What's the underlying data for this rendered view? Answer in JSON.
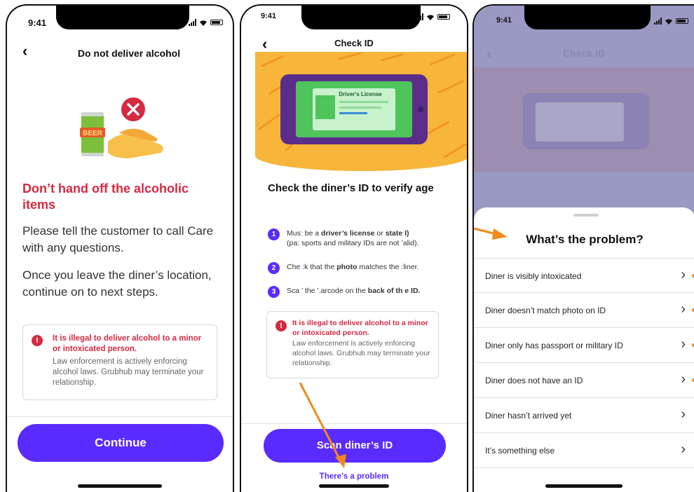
{
  "status": {
    "time": "9:41"
  },
  "screen1": {
    "title": "Do not deliver alcohol",
    "can_label": "BEER",
    "headline": "Don’t hand off the alcoholic items",
    "body1": "Please tell the customer to call Care with any questions.",
    "body2": "Once you leave the diner’s location, continue on to next steps.",
    "warning_title": "It is illegal to deliver alcohol to a minor or intoxicated person.",
    "warning_body": "Law enforcement is actively enforcing alcohol laws. Grubhub may terminate your relationship.",
    "button": "Continue"
  },
  "screen2": {
    "title": "Check ID",
    "card_label": "Driver's License",
    "headline": "Check the diner’s ID to verify age",
    "steps": [
      {
        "num": "1",
        "pre": "Mus",
        "mid1": ": be a ",
        "bold1": "driver’s license",
        "mid2": " or ",
        "bold2": "state I",
        "tail": ")",
        "line2": "(pa: sports  and military IDs are not ’alid)."
      },
      {
        "num": "2",
        "pre": "Che :k that the ",
        "bold1": "photo",
        "post": " matches the :liner."
      },
      {
        "num": "3",
        "pre": "Sca ’ the ’.arcode on the ",
        "bold1": "back of th e ID."
      }
    ],
    "warning_title": "It is illegal to deliver alcohol to a minor or intoxicated person.",
    "warning_body": "Law enforcement is actively enforcing alcohol laws. Grubhub may terminate your relationship.",
    "button": "Scan diner’s ID",
    "link": "There’s a problem"
  },
  "screen3": {
    "title": "Check ID",
    "sheet_title": "What’s the problem?",
    "options": [
      {
        "label": "Diner is visibly intoxicated",
        "marked": true
      },
      {
        "label": "Diner doesn’t match photo on ID",
        "marked": true
      },
      {
        "label": "Diner only has passport or military ID",
        "marked": true
      },
      {
        "label": "Diner does not have an ID",
        "marked": true
      },
      {
        "label": "Diner hasn’t arrived yet",
        "marked": false
      },
      {
        "label": "It’s something else",
        "marked": false
      }
    ]
  },
  "colors": {
    "brand_purple": "#5a2bff",
    "alert_red": "#d42a42",
    "banner_yellow": "#f7b53a",
    "annotation_orange": "#f08a1d"
  }
}
